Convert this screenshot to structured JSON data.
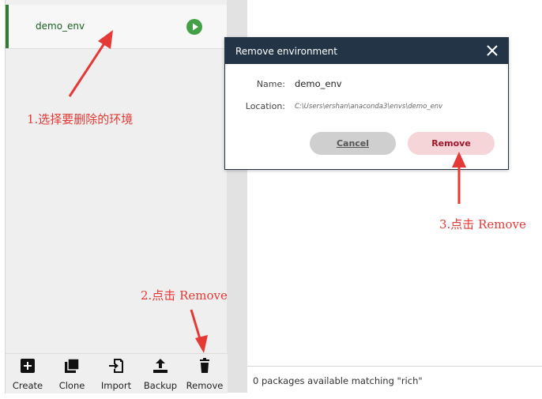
{
  "environments": {
    "items": [
      {
        "name": "demo_env",
        "selected": true
      }
    ]
  },
  "toolbar": {
    "create_label": "Create",
    "clone_label": "Clone",
    "import_label": "Import",
    "backup_label": "Backup",
    "remove_label": "Remove"
  },
  "status": {
    "text": "0 packages available matching \"rich\""
  },
  "dialog": {
    "title": "Remove environment",
    "name_label": "Name:",
    "name_value": "demo_env",
    "location_label": "Location:",
    "location_value": "C:\\Users\\ershan\\anaconda3\\envs\\demo_env",
    "cancel_label": "Cancel",
    "remove_label": "Remove"
  },
  "annotations": {
    "step1": "1.选择要删除的环境",
    "step2": "2.点击 Remove",
    "step3": "3.点击 Remove"
  },
  "colors": {
    "accent_green": "#2e7d32",
    "play_green": "#43a047",
    "dialog_header": "#243447",
    "remove_button_bg": "#f6d5d8",
    "remove_button_text": "#a0152a",
    "annotation_red": "#e53935"
  }
}
